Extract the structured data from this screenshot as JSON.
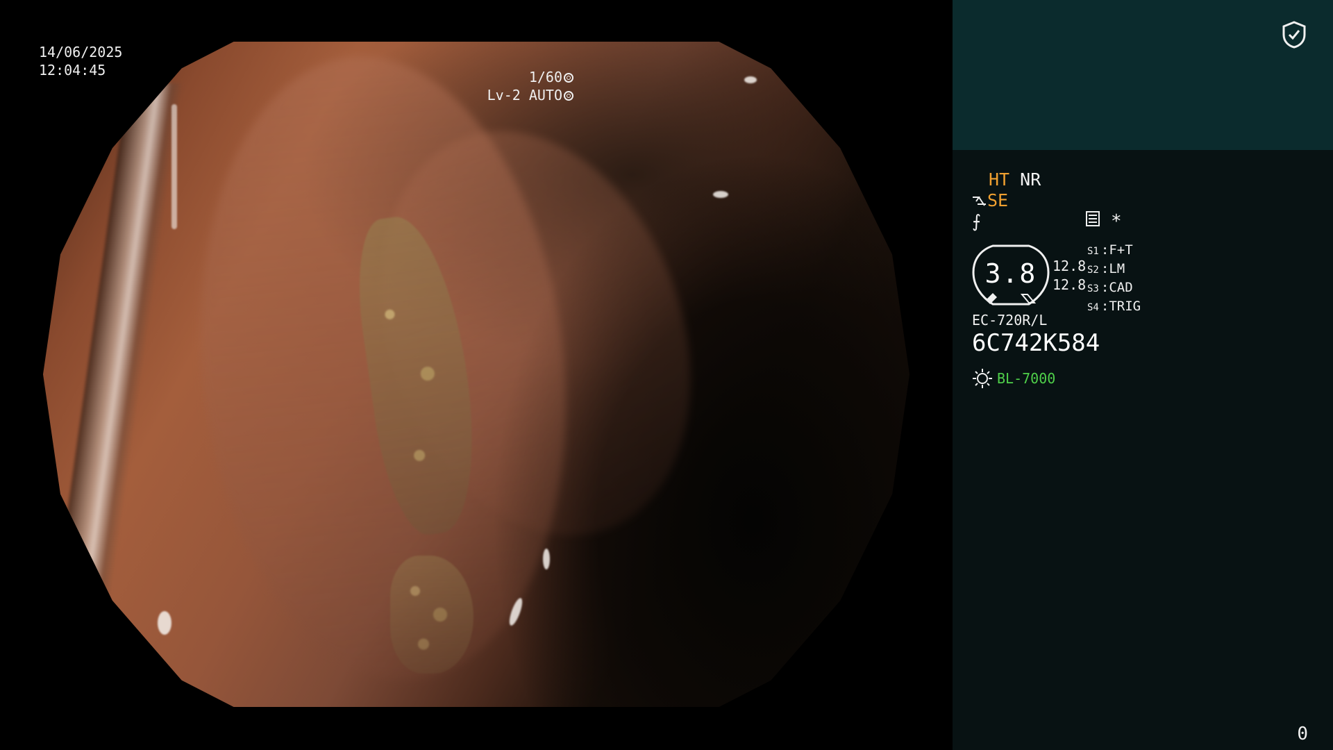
{
  "overlay": {
    "date": "14/06/2025",
    "time": "12:04:45",
    "shutter": "1/60",
    "exposure": "Lv-2 AUTO"
  },
  "panel": {
    "top_icon": "shield-check-icon",
    "ht_label": "HT",
    "nr_label": "NR",
    "se_label": "SE",
    "f_label": "⨍",
    "asterisk": "*",
    "dial_value": "3.8",
    "dial_val_1": "12.8",
    "dial_val_2": "12.8",
    "modes": [
      {
        "key": "S1",
        "value": "F+T"
      },
      {
        "key": "S2",
        "value": "LM"
      },
      {
        "key": "S3",
        "value": "CAD"
      },
      {
        "key": "S4",
        "value": "TRIG"
      }
    ],
    "scope_model": "EC-720R/L",
    "scope_serial": "6C742K584",
    "light_source": "BL-7000",
    "counter": "0"
  },
  "colors": {
    "panel_bg": "#081213",
    "panel_top_bg": "#0b2b2d",
    "amber": "#f0a030",
    "green": "#4fd04a"
  }
}
